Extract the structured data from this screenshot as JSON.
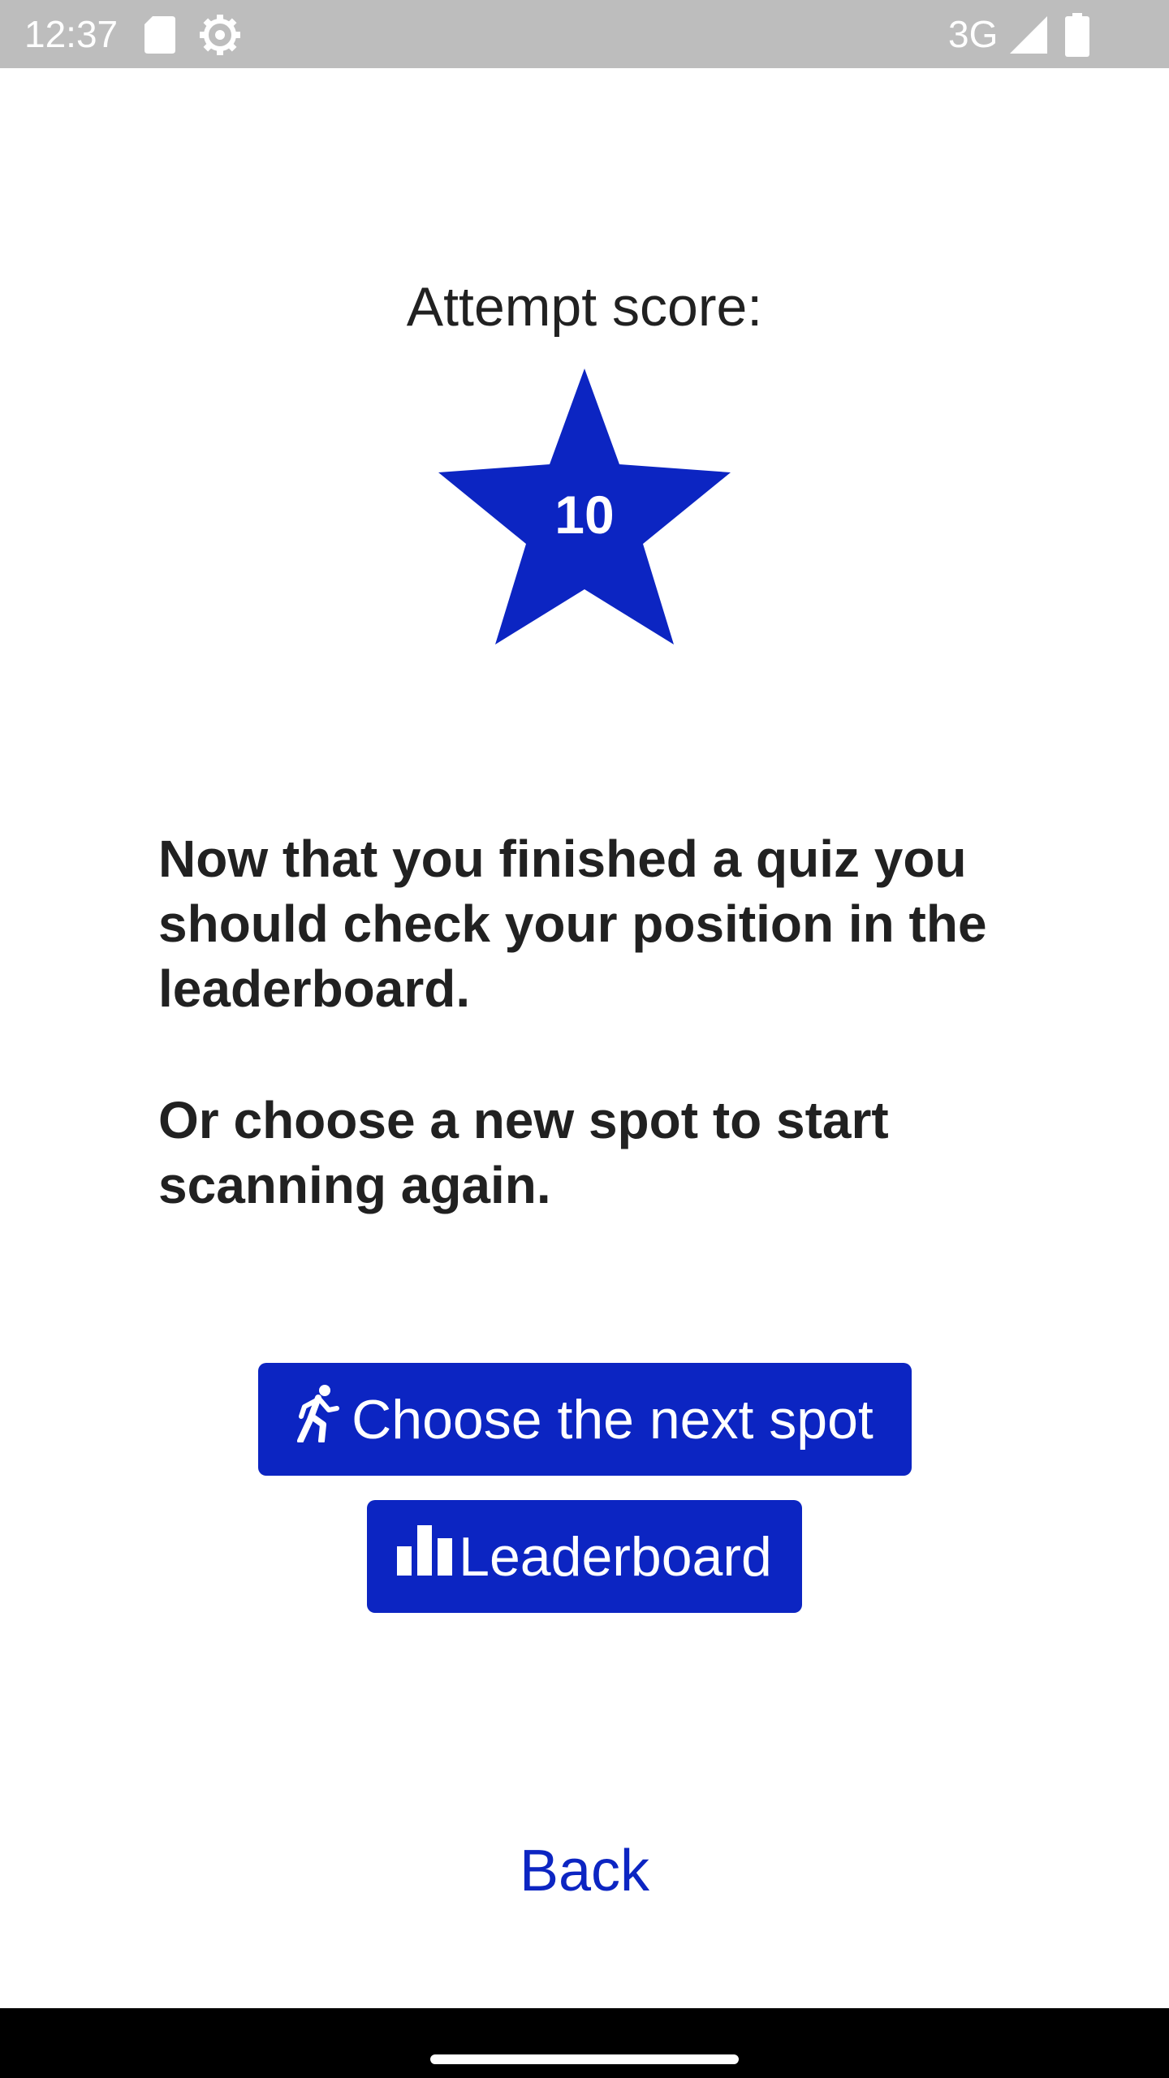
{
  "status_bar": {
    "time": "12:37",
    "network": "3G",
    "icons": [
      "sd-card-icon",
      "settings-icon",
      "signal-icon",
      "battery-icon"
    ]
  },
  "score": {
    "title": "Attempt score:",
    "value": "10",
    "star_color": "#0c25c2"
  },
  "message": {
    "paragraph1": "Now that you finished a quiz you should check your position in the leaderboard.",
    "paragraph2": "Or choose a new spot to start scanning again."
  },
  "buttons": {
    "next_spot": "Choose the next spot",
    "leaderboard": "Leaderboard",
    "back": "Back"
  },
  "colors": {
    "accent": "#0c25c2",
    "status_bar": "#bdbdbd",
    "text": "#212121"
  }
}
